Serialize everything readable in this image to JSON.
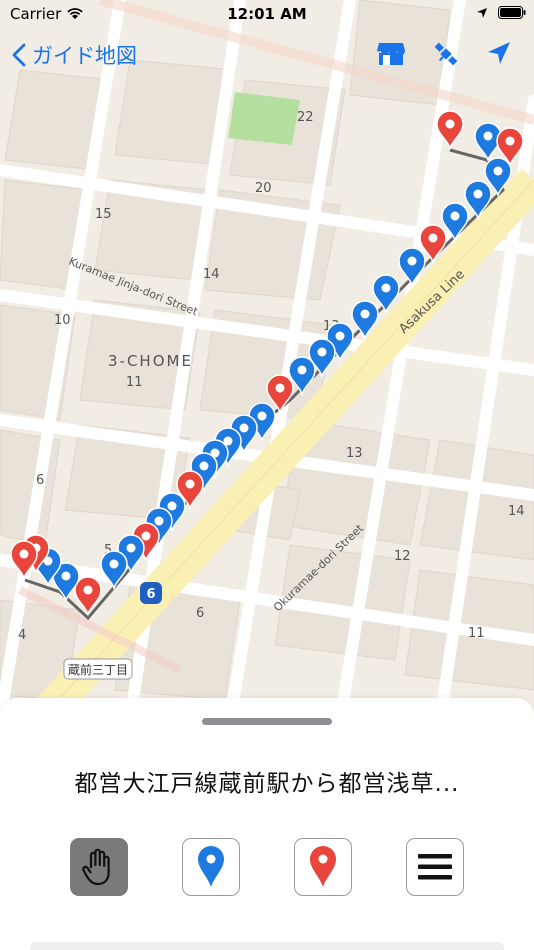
{
  "status_bar": {
    "carrier": "Carrier",
    "time": "12:01 AM"
  },
  "nav": {
    "back_label": "ガイド地図",
    "icons": [
      "store-icon",
      "satellite-icon",
      "location-arrow-icon"
    ]
  },
  "map": {
    "block_numbers": [
      "22",
      "20",
      "15",
      "14",
      "10",
      "3-CHOME",
      "11",
      "13",
      "13",
      "6",
      "5",
      "4",
      "6",
      "12",
      "14",
      "11"
    ],
    "street_labels": [
      "Kuramae Jinja-dori Street",
      "Asakusa Line",
      "Okuramae-dori Street"
    ],
    "station_label": "蔵前三丁目",
    "route_badge": "6"
  },
  "sheet": {
    "title": "都営大江戸線蔵前駅から都営浅草...",
    "tools": [
      "hand-tool",
      "blue-pin-tool",
      "red-pin-tool",
      "menu"
    ]
  },
  "colors": {
    "accent": "#1a73e8",
    "red_pin": "#e8453c",
    "blue_pin": "#1f7ae0",
    "map_bg": "#f4efe6",
    "road": "#ffffff",
    "park": "#b5df9f",
    "highway": "#fbf0b3"
  }
}
